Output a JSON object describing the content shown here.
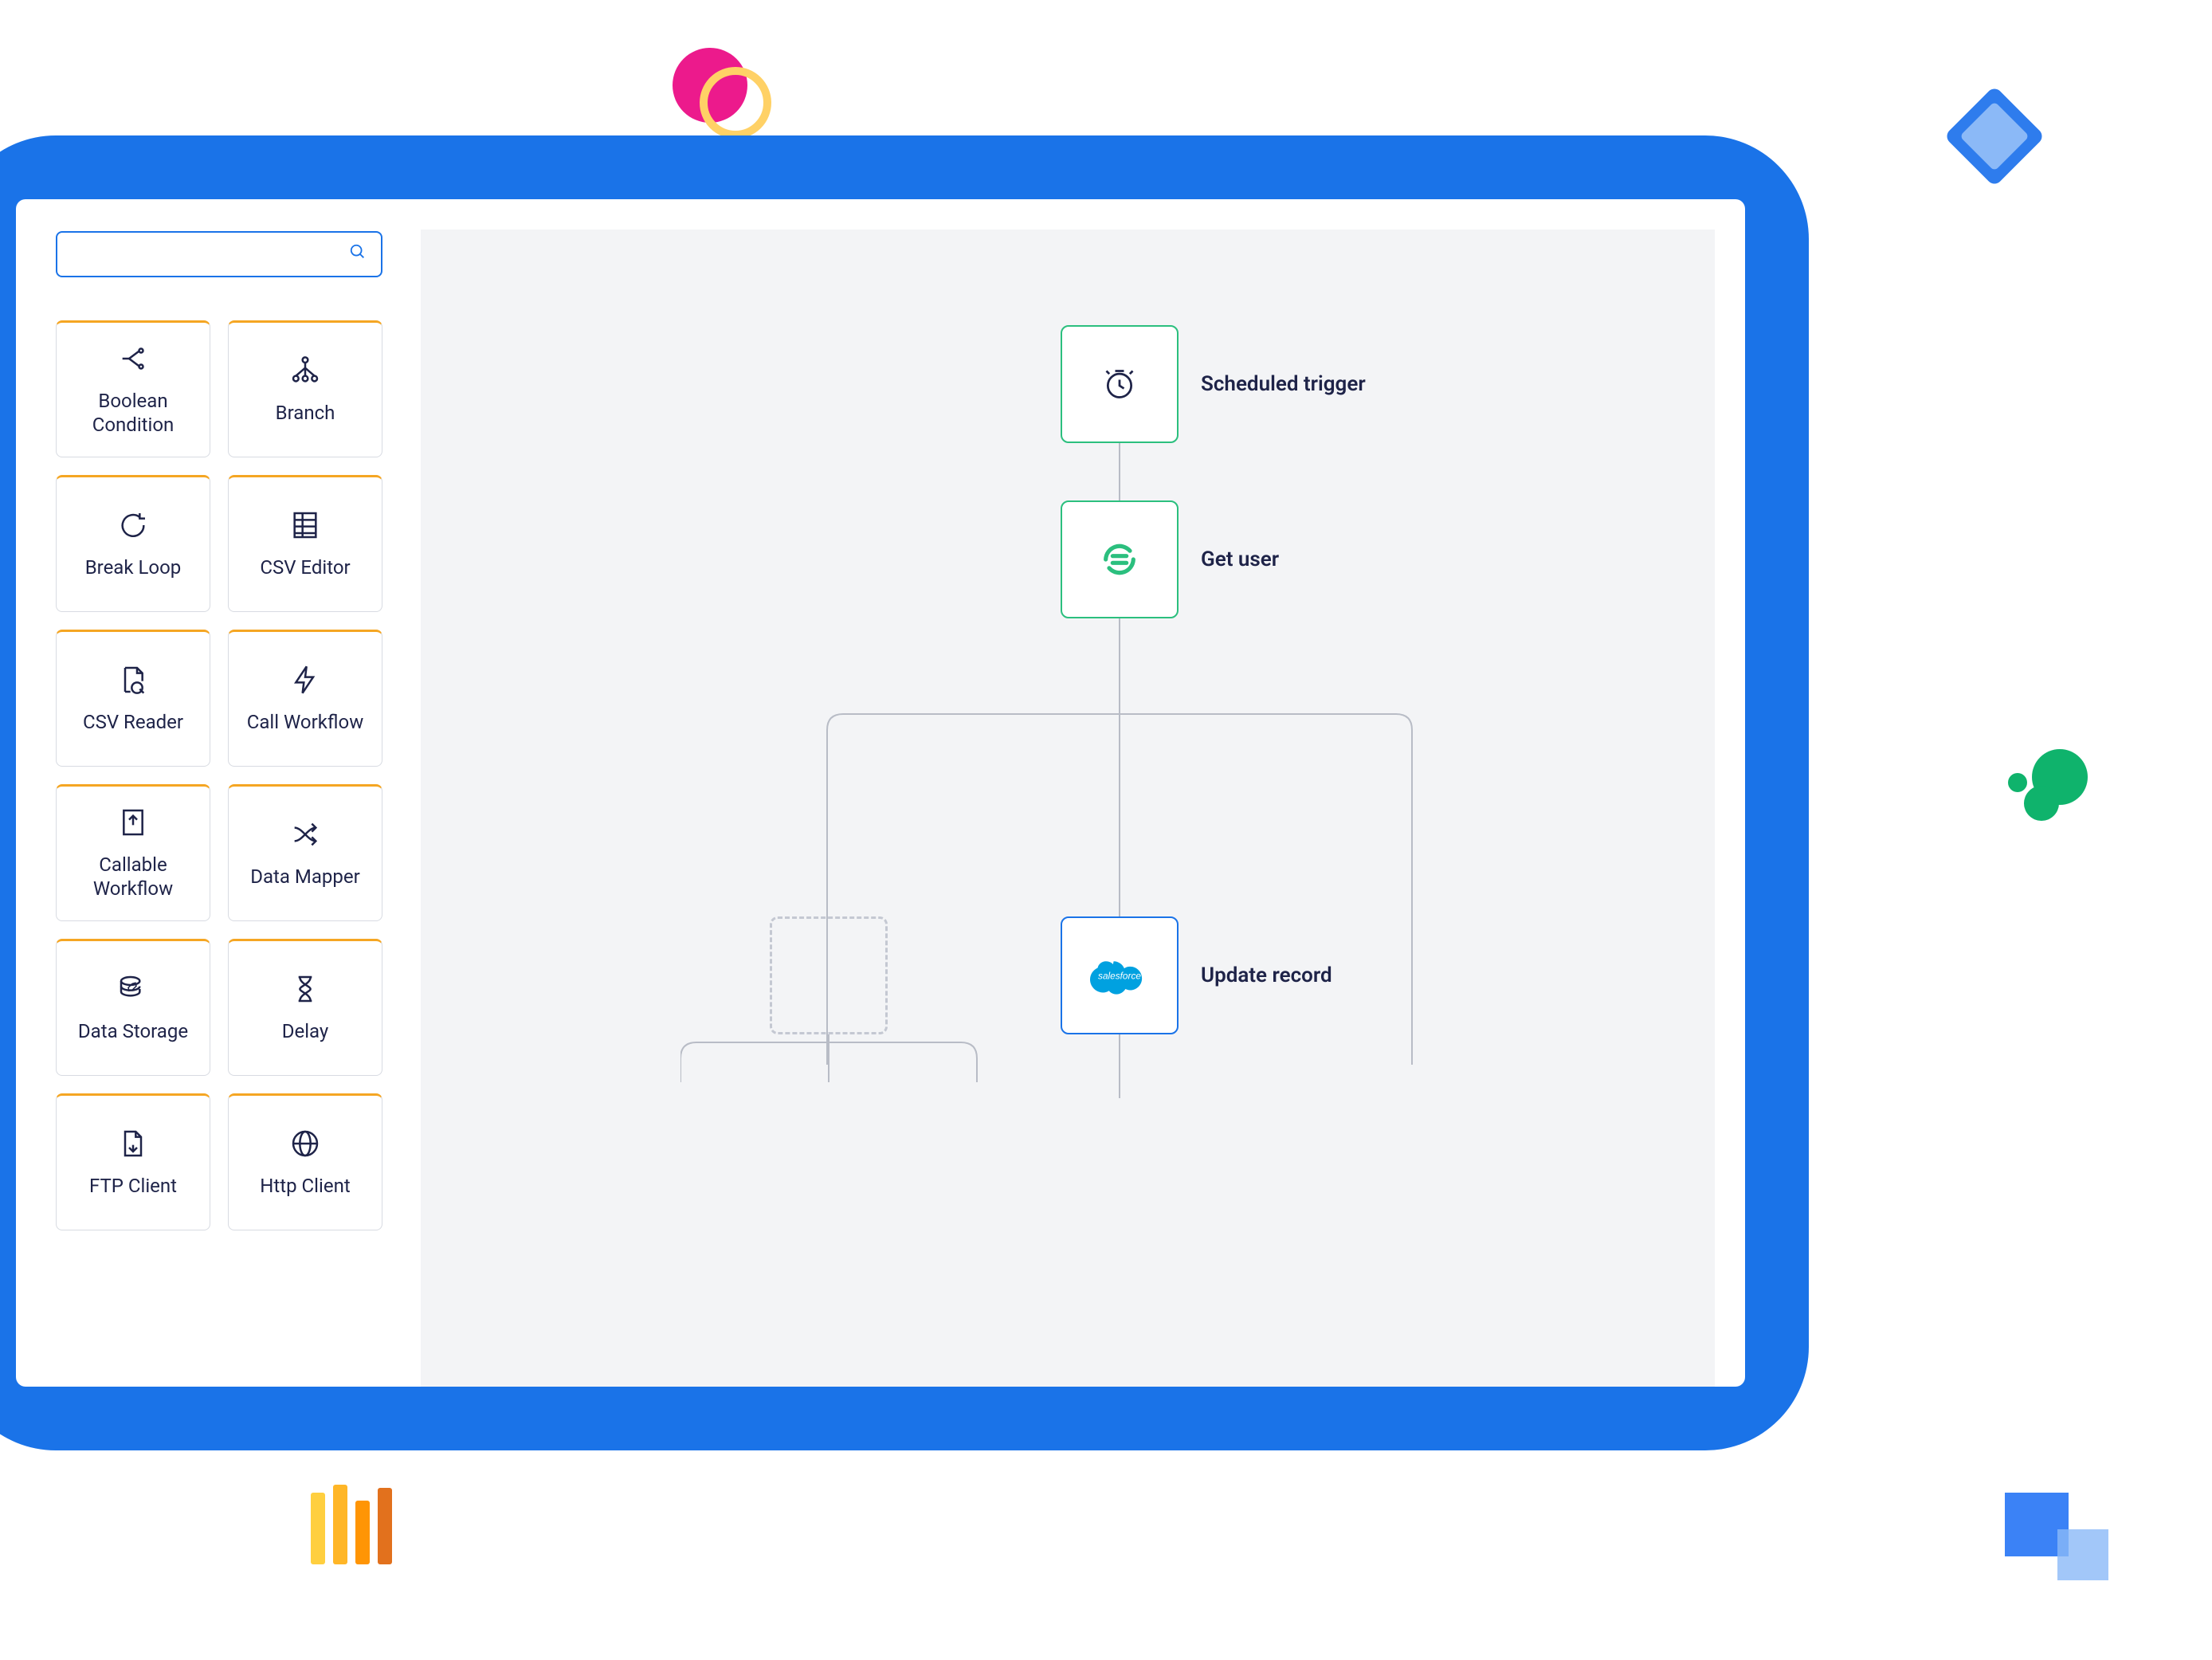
{
  "search": {
    "placeholder": ""
  },
  "palette": [
    {
      "label": "Boolean Condition",
      "icon": "boolean"
    },
    {
      "label": "Branch",
      "icon": "branch"
    },
    {
      "label": "Break Loop",
      "icon": "breakloop"
    },
    {
      "label": "CSV Editor",
      "icon": "csveditor"
    },
    {
      "label": "CSV Reader",
      "icon": "csvreader"
    },
    {
      "label": "Call Workflow",
      "icon": "callworkflow"
    },
    {
      "label": "Callable Workflow",
      "icon": "callable"
    },
    {
      "label": "Data Mapper",
      "icon": "datamapper"
    },
    {
      "label": "Data Storage",
      "icon": "datastorage"
    },
    {
      "label": "Delay",
      "icon": "delay"
    },
    {
      "label": "FTP Client",
      "icon": "ftp"
    },
    {
      "label": "Http Client",
      "icon": "http"
    }
  ],
  "nodes": {
    "trigger": {
      "label": "Scheduled trigger"
    },
    "getuser": {
      "label": "Get user"
    },
    "update": {
      "label": "Update record"
    }
  }
}
